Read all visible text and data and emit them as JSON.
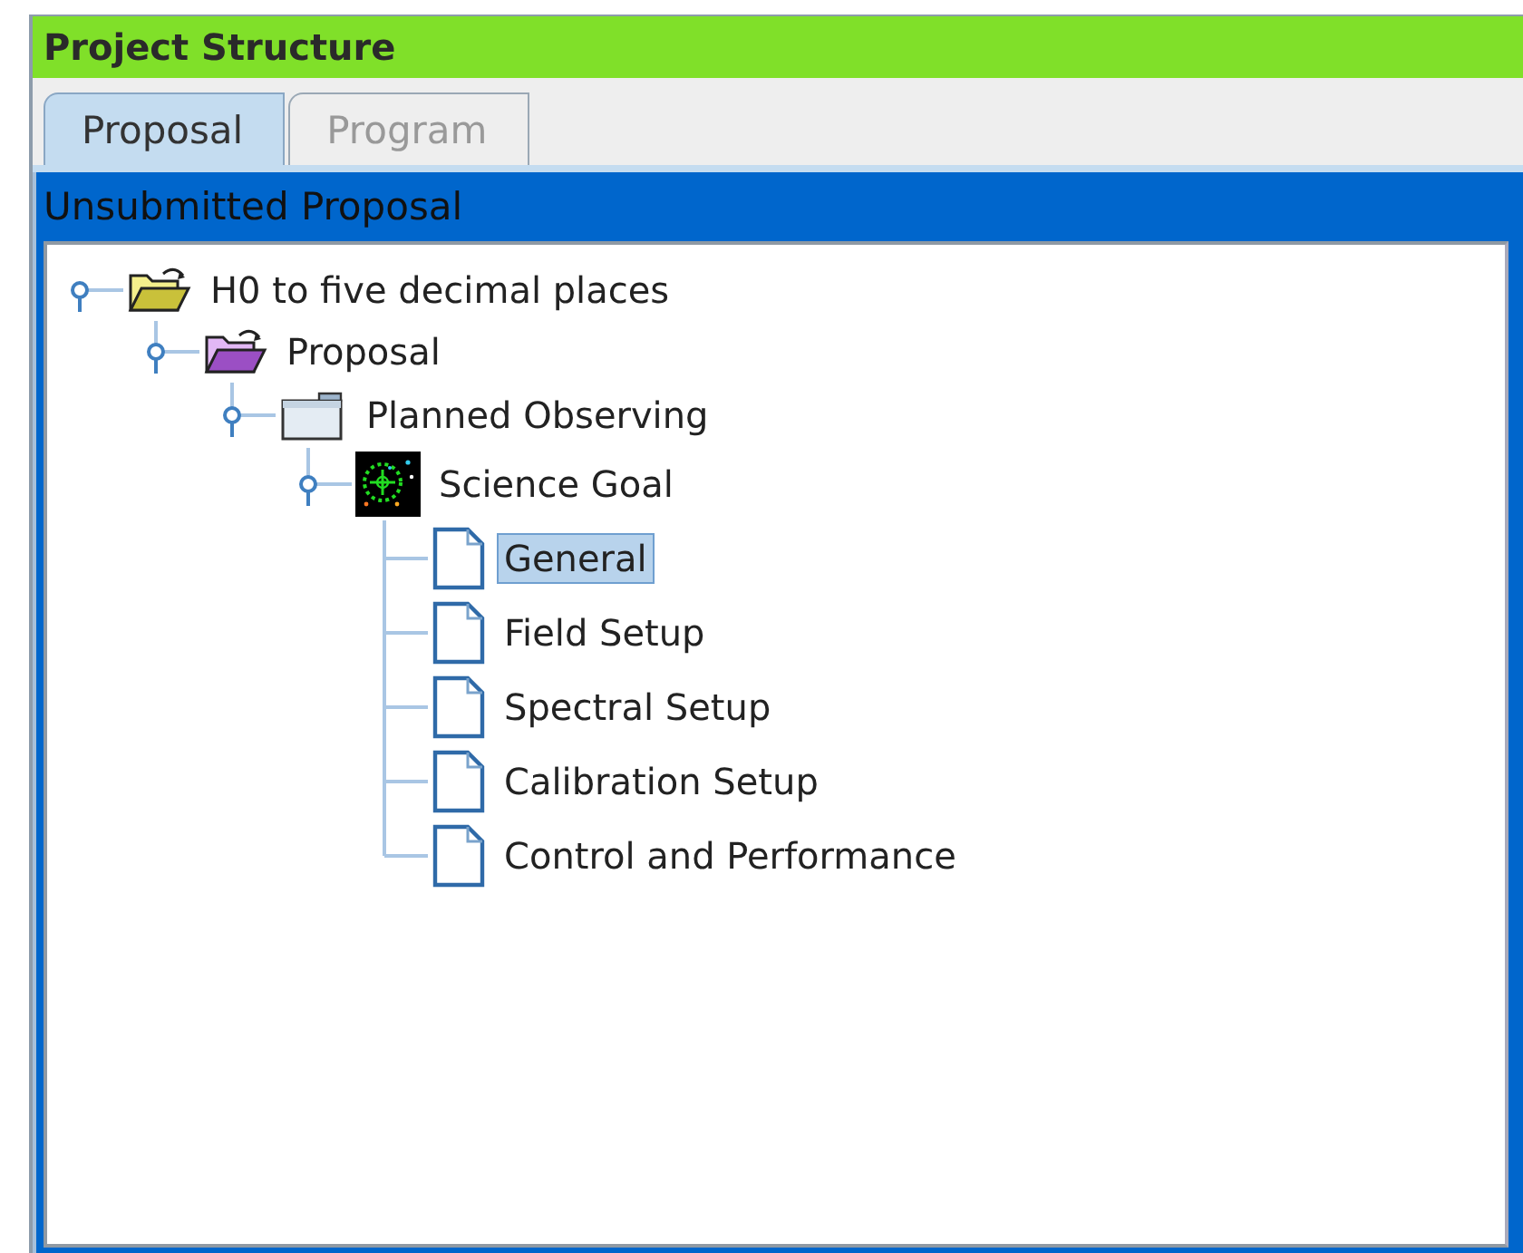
{
  "window": {
    "title": "Project Structure"
  },
  "tabs": [
    {
      "label": "Proposal",
      "selected": true
    },
    {
      "label": "Program",
      "selected": false
    }
  ],
  "panel": {
    "title": "Unsubmitted Proposal"
  },
  "tree": [
    {
      "label": "H0 to five decimal places",
      "kind": "project",
      "expanded": true,
      "selected": false,
      "children": [
        {
          "label": "Proposal",
          "kind": "proposal",
          "expanded": true,
          "selected": false,
          "children": [
            {
              "label": "Planned Observing",
              "kind": "folder",
              "expanded": true,
              "selected": false,
              "children": [
                {
                  "label": "Science Goal",
                  "kind": "goal",
                  "expanded": true,
                  "selected": false,
                  "children": [
                    {
                      "label": "General",
                      "kind": "page",
                      "selected": true
                    },
                    {
                      "label": "Field Setup",
                      "kind": "page",
                      "selected": false
                    },
                    {
                      "label": "Spectral Setup",
                      "kind": "page",
                      "selected": false
                    },
                    {
                      "label": "Calibration Setup",
                      "kind": "page",
                      "selected": false
                    },
                    {
                      "label": "Control and Performance",
                      "kind": "page",
                      "selected": false
                    }
                  ]
                }
              ]
            }
          ]
        }
      ]
    }
  ]
}
